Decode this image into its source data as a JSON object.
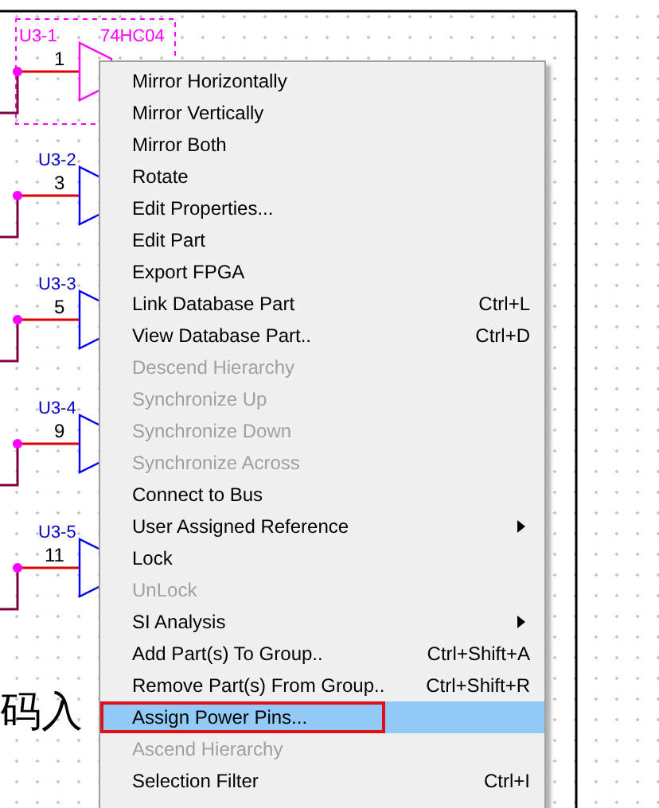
{
  "schematic": {
    "parts": [
      {
        "ref": "U3-1",
        "value": "74HC04",
        "input_pin": "1",
        "selected": true
      },
      {
        "ref": "U3-2",
        "input_pin": "3",
        "selected": false
      },
      {
        "ref": "U3-3",
        "input_pin": "5",
        "selected": false
      },
      {
        "ref": "U3-4",
        "input_pin": "9",
        "selected": false
      },
      {
        "ref": "U3-5",
        "input_pin": "11",
        "selected": false
      }
    ],
    "text": "码入"
  },
  "context_menu": {
    "items": [
      {
        "label": "Mirror Horizontally",
        "disabled": false,
        "selected": false
      },
      {
        "label": "Mirror Vertically",
        "disabled": false,
        "selected": false
      },
      {
        "label": "Mirror Both",
        "disabled": false,
        "selected": false
      },
      {
        "label": "Rotate",
        "disabled": false,
        "selected": false
      },
      {
        "label": "Edit Properties...",
        "disabled": false,
        "selected": false
      },
      {
        "label": "Edit Part",
        "disabled": false,
        "selected": false
      },
      {
        "label": "Export FPGA",
        "disabled": false,
        "selected": false
      },
      {
        "label": "Link Database Part",
        "shortcut": "Ctrl+L",
        "disabled": false,
        "selected": false
      },
      {
        "label": "View Database Part..",
        "shortcut": "Ctrl+D",
        "disabled": false,
        "selected": false
      },
      {
        "label": "Descend Hierarchy",
        "disabled": true,
        "selected": false
      },
      {
        "label": "Synchronize Up",
        "disabled": true,
        "selected": false
      },
      {
        "label": "Synchronize Down",
        "disabled": true,
        "selected": false
      },
      {
        "label": "Synchronize Across",
        "disabled": true,
        "selected": false
      },
      {
        "label": "Connect to Bus",
        "disabled": false,
        "selected": false
      },
      {
        "label": "User Assigned Reference",
        "submenu": true,
        "disabled": false,
        "selected": false
      },
      {
        "label": "Lock",
        "disabled": false,
        "selected": false
      },
      {
        "label": "UnLock",
        "disabled": true,
        "selected": false
      },
      {
        "label": "SI Analysis",
        "submenu": true,
        "disabled": false,
        "selected": false
      },
      {
        "label": "Add Part(s) To Group..",
        "shortcut": "Ctrl+Shift+A",
        "disabled": false,
        "selected": false
      },
      {
        "label": "Remove Part(s) From Group..",
        "shortcut": "Ctrl+Shift+R",
        "disabled": false,
        "selected": false
      },
      {
        "label": "Assign Power Pins...",
        "disabled": false,
        "selected": true,
        "annotated": true
      },
      {
        "label": "Ascend Hierarchy",
        "disabled": true,
        "selected": false
      },
      {
        "label": "Selection Filter",
        "shortcut": "Ctrl+I",
        "disabled": false,
        "selected": false
      }
    ]
  }
}
